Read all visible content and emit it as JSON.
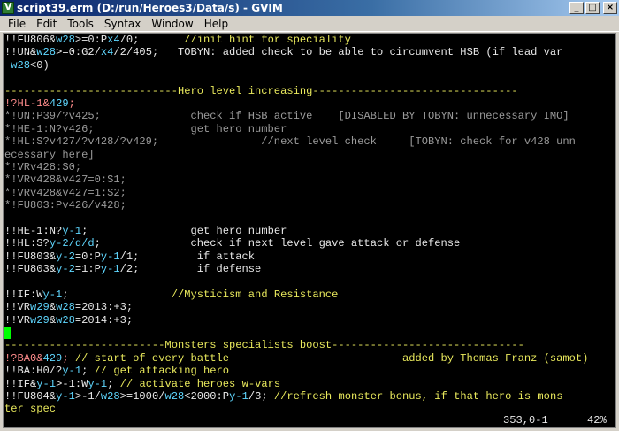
{
  "window": {
    "title": "script39.erm (D:/run/Heroes3/Data/s) - GVIM",
    "controls": {
      "minimize": "_",
      "maximize": "□",
      "close": "×"
    }
  },
  "menu": [
    "File",
    "Edit",
    "Tools",
    "Syntax",
    "Window",
    "Help"
  ],
  "editor": {
    "lines": [
      [
        [
          "erm",
          "!!FU806&"
        ],
        [
          "var",
          "w28"
        ],
        [
          "erm",
          ">=0:P"
        ],
        [
          "var",
          "x4"
        ],
        [
          "erm",
          "/0;"
        ],
        [
          "cmt",
          "       //init hint for speciality"
        ]
      ],
      [
        [
          "erm",
          "!!UN&"
        ],
        [
          "var",
          "w28"
        ],
        [
          "erm",
          ">=0:G2/"
        ],
        [
          "var",
          "x4"
        ],
        [
          "erm",
          "/2/405;   TOBYN: added check to be able to circumvent HSB (if lead var"
        ]
      ],
      [
        [
          "erm",
          " "
        ],
        [
          "var",
          "w28"
        ],
        [
          "erm",
          "<0)"
        ]
      ],
      [
        [
          "erm",
          ""
        ]
      ],
      [
        [
          "sep",
          "---------------------------Hero level increasing--------------------------------"
        ]
      ],
      [
        [
          "trg",
          "!?HL-1&"
        ],
        [
          "var",
          "429"
        ],
        [
          "trg",
          ";"
        ]
      ],
      [
        [
          "off",
          "*!UN:P39/?v425;              check if HSB active    [DISABLED BY TOBYN: unnecessary IMO]"
        ]
      ],
      [
        [
          "off",
          "*!HE-1:N?v426;               get hero number"
        ]
      ],
      [
        [
          "off",
          "*!HL:S?v427/?v428/?v429;                //next level check     [TOBYN: check for v428 unn"
        ]
      ],
      [
        [
          "off",
          "ecessary here]"
        ]
      ],
      [
        [
          "off",
          "*!VRv428:S0;"
        ]
      ],
      [
        [
          "off",
          "*!VRv428&v427=0:S1;"
        ]
      ],
      [
        [
          "off",
          "*!VRv428&v427=1:S2;"
        ]
      ],
      [
        [
          "off",
          "*!FU803:Pv426/v428;"
        ]
      ],
      [
        [
          "erm",
          ""
        ]
      ],
      [
        [
          "erm",
          "!!HE-1:N?"
        ],
        [
          "var",
          "y-1"
        ],
        [
          "erm",
          ";                get hero number"
        ]
      ],
      [
        [
          "erm",
          "!!HL:S?"
        ],
        [
          "var",
          "y-2/d/d"
        ],
        [
          "erm",
          ";              check if next level gave attack or defense"
        ]
      ],
      [
        [
          "erm",
          "!!FU803&"
        ],
        [
          "var",
          "y-2"
        ],
        [
          "erm",
          "=0:P"
        ],
        [
          "var",
          "y-1"
        ],
        [
          "erm",
          "/1;         if attack"
        ]
      ],
      [
        [
          "erm",
          "!!FU803&"
        ],
        [
          "var",
          "y-2"
        ],
        [
          "erm",
          "=1:P"
        ],
        [
          "var",
          "y-1"
        ],
        [
          "erm",
          "/2;         if defense"
        ]
      ],
      [
        [
          "erm",
          ""
        ]
      ],
      [
        [
          "erm",
          "!!IF:W"
        ],
        [
          "var",
          "y-1"
        ],
        [
          "erm",
          ";"
        ],
        [
          "cmt",
          "                //Mysticism and Resistance"
        ]
      ],
      [
        [
          "erm",
          "!!VR"
        ],
        [
          "var",
          "w29"
        ],
        [
          "erm",
          "&"
        ],
        [
          "var",
          "w28"
        ],
        [
          "erm",
          "=2013:+3;"
        ]
      ],
      [
        [
          "erm",
          "!!VR"
        ],
        [
          "var",
          "w29"
        ],
        [
          "erm",
          "&"
        ],
        [
          "var",
          "w28"
        ],
        [
          "erm",
          "=2014:+3;"
        ]
      ],
      [
        [
          "cursor",
          ""
        ]
      ],
      [
        [
          "sep",
          "-------------------------Monsters specialists boost------------------------------"
        ]
      ],
      [
        [
          "trg",
          "!?BA0&"
        ],
        [
          "var",
          "429"
        ],
        [
          "trg",
          "; "
        ],
        [
          "cmt",
          "// start of every battle                           added by Thomas Franz (samot)"
        ]
      ],
      [
        [
          "erm",
          "!!BA:H0/?"
        ],
        [
          "var",
          "y-1"
        ],
        [
          "erm",
          "; "
        ],
        [
          "cmt",
          "// get attacking hero"
        ]
      ],
      [
        [
          "erm",
          "!!IF&"
        ],
        [
          "var",
          "y-1"
        ],
        [
          "erm",
          ">-1:W"
        ],
        [
          "var",
          "y-1"
        ],
        [
          "erm",
          "; "
        ],
        [
          "cmt",
          "// activate heroes w-vars"
        ]
      ],
      [
        [
          "erm",
          "!!FU804&"
        ],
        [
          "var",
          "y-1"
        ],
        [
          "erm",
          ">-1/"
        ],
        [
          "var",
          "w28"
        ],
        [
          "erm",
          ">=1000/"
        ],
        [
          "var",
          "w28"
        ],
        [
          "erm",
          "<2000:P"
        ],
        [
          "var",
          "y-1"
        ],
        [
          "erm",
          "/3; "
        ],
        [
          "cmt",
          "//refresh monster bonus, if that hero is mons"
        ]
      ],
      [
        [
          "cmt",
          "ter spec"
        ]
      ]
    ]
  },
  "status": {
    "position": "353,0-1",
    "percent": "42%"
  }
}
